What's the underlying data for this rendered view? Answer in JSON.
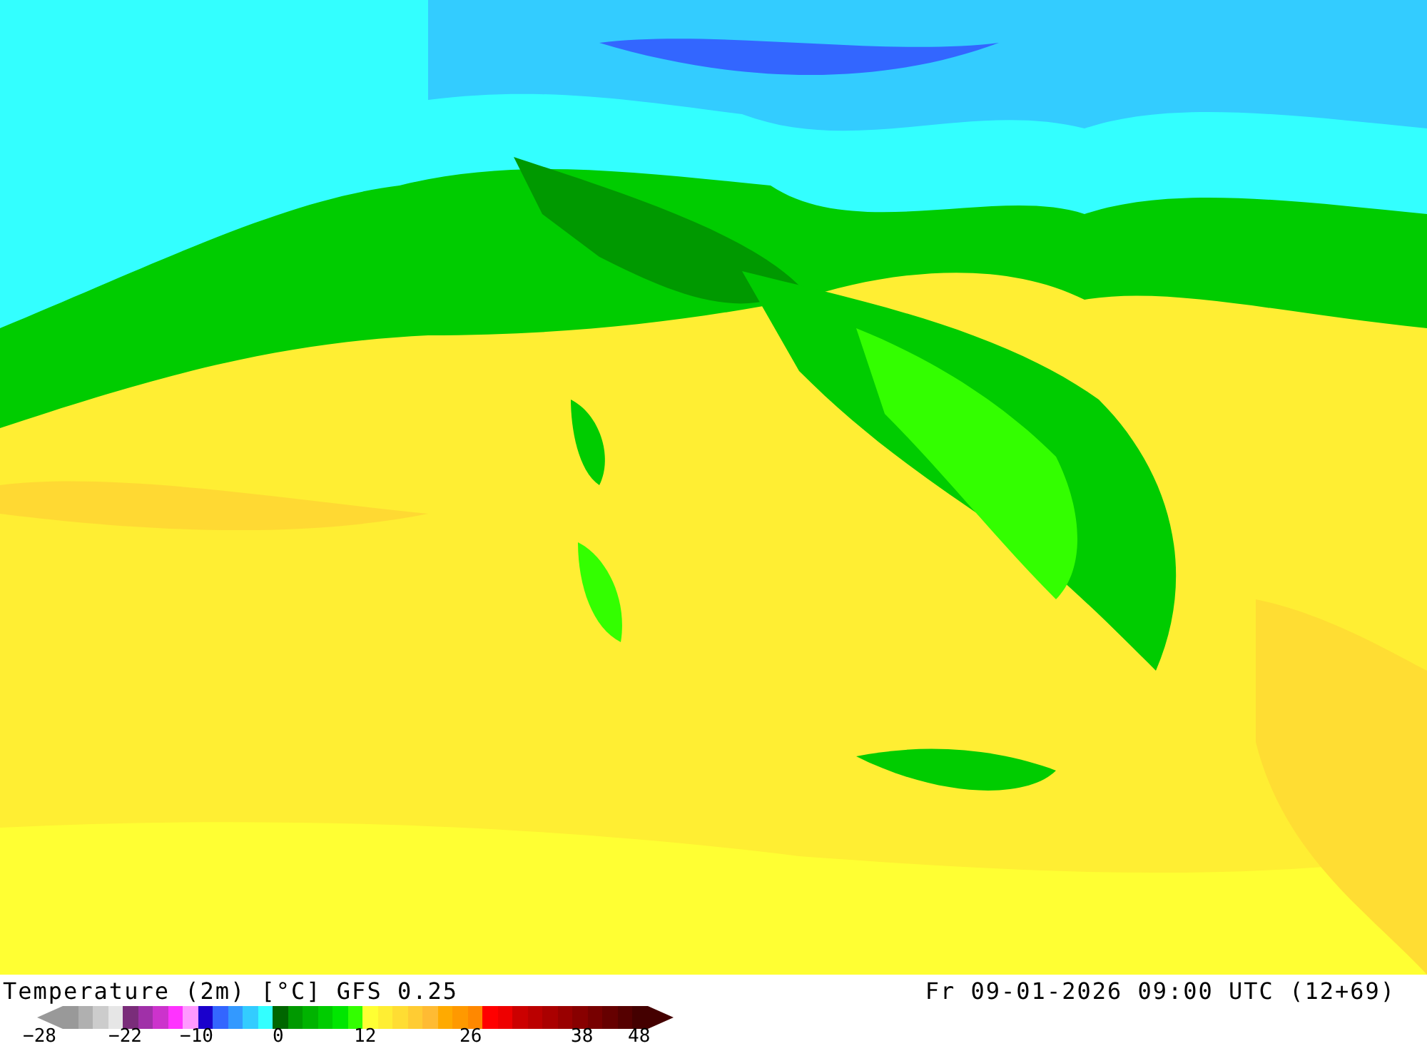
{
  "caption": {
    "title": "Temperature (2m) [°C] GFS 0.25",
    "valid_time": "Fr 09-01-2026 09:00 UTC (12+69)"
  },
  "legend": {
    "swatches": [
      {
        "color": "#999999"
      },
      {
        "color": "#b0b0b0"
      },
      {
        "color": "#cccccc"
      },
      {
        "color": "#e6e6e6"
      },
      {
        "color": "#7a2d7a"
      },
      {
        "color": "#a030a8"
      },
      {
        "color": "#cc33cc"
      },
      {
        "color": "#ff33ff"
      },
      {
        "color": "#ff99ff"
      },
      {
        "color": "#1a00cc"
      },
      {
        "color": "#3366ff"
      },
      {
        "color": "#3399ff"
      },
      {
        "color": "#33ccff"
      },
      {
        "color": "#33ffff"
      },
      {
        "color": "#006600"
      },
      {
        "color": "#009900"
      },
      {
        "color": "#00b300"
      },
      {
        "color": "#00cc00"
      },
      {
        "color": "#00e600"
      },
      {
        "color": "#33ff00"
      },
      {
        "color": "#ffff33"
      },
      {
        "color": "#ffee33"
      },
      {
        "color": "#ffdd33"
      },
      {
        "color": "#ffcc33"
      },
      {
        "color": "#ffbb33"
      },
      {
        "color": "#ffaa00"
      },
      {
        "color": "#ff9900"
      },
      {
        "color": "#ff8800"
      },
      {
        "color": "#ff0000"
      },
      {
        "color": "#ee0000"
      },
      {
        "color": "#cc0000"
      },
      {
        "color": "#bb0000"
      },
      {
        "color": "#aa0000"
      },
      {
        "color": "#990000"
      },
      {
        "color": "#880000"
      },
      {
        "color": "#770000"
      },
      {
        "color": "#660000"
      },
      {
        "color": "#550000"
      },
      {
        "color": "#440000"
      }
    ],
    "ticks": [
      "−28",
      "−22",
      "−10",
      "0",
      "12",
      "26",
      "38",
      "48"
    ]
  }
}
